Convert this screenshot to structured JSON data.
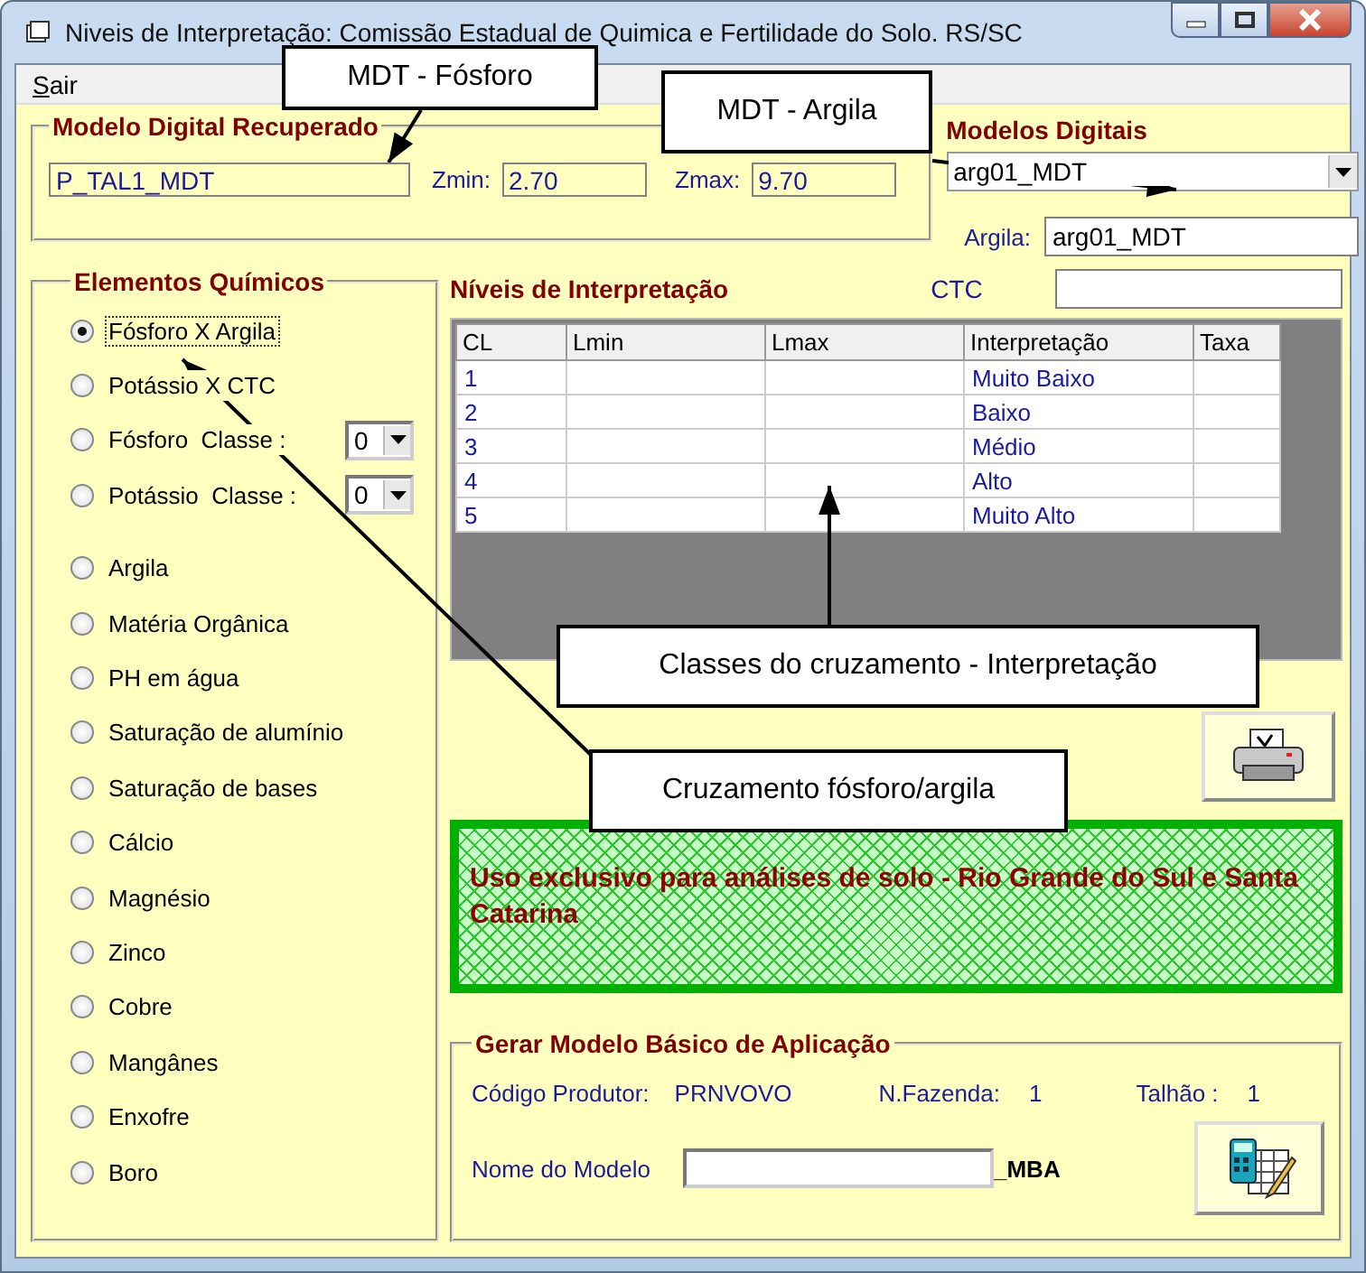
{
  "window": {
    "title": "Niveis de Interpretação: Comissão Estadual de Quimica e Fertilidade do Solo.  RS/SC"
  },
  "menu": [
    {
      "label": "Sair"
    }
  ],
  "modelo_digital_recuperado": {
    "title": "Modelo Digital Recuperado",
    "model": "P_TAL1_MDT",
    "zmin_label": "Zmin:",
    "zmin": "2.70",
    "zmax_label": "Zmax:",
    "zmax": "9.70"
  },
  "modelos_digitais": {
    "title": "Modelos Digitais",
    "combo_value": "arg01_MDT",
    "argila_label": "Argila:",
    "argila_value": "arg01_MDT",
    "ctc_label": "CTC"
  },
  "elementos": {
    "title": "Elementos Químicos",
    "items": [
      {
        "kind": "radio",
        "label": "Fósforo X Argila",
        "selected": true,
        "focused": true
      },
      {
        "kind": "radio",
        "label": "Potássio X CTC",
        "selected": false,
        "focused": false
      },
      {
        "kind": "combo",
        "label": "Fósforo  Classe :",
        "selected": false,
        "focused": false,
        "class_value": "0"
      },
      {
        "kind": "combo",
        "label": "Potássio  Classe :",
        "selected": false,
        "focused": false,
        "class_value": "0"
      },
      {
        "kind": "radio",
        "label": "Argila",
        "selected": false,
        "focused": false
      },
      {
        "kind": "radio",
        "label": "Matéria Orgânica",
        "selected": false,
        "focused": false
      },
      {
        "kind": "radio",
        "label": "PH em água",
        "selected": false,
        "focused": false
      },
      {
        "kind": "radio",
        "label": "Saturação de alumínio",
        "selected": false,
        "focused": false
      },
      {
        "kind": "radio",
        "label": "Saturação de bases",
        "selected": false,
        "focused": false
      },
      {
        "kind": "radio",
        "label": "Cálcio",
        "selected": false,
        "focused": false
      },
      {
        "kind": "radio",
        "label": "Magnésio",
        "selected": false,
        "focused": false
      },
      {
        "kind": "radio",
        "label": "Zinco",
        "selected": false,
        "focused": false
      },
      {
        "kind": "radio",
        "label": "Cobre",
        "selected": false,
        "focused": false
      },
      {
        "kind": "radio",
        "label": "Mangânes",
        "selected": false,
        "focused": false
      },
      {
        "kind": "radio",
        "label": "Enxofre",
        "selected": false,
        "focused": false
      },
      {
        "kind": "radio",
        "label": "Boro",
        "selected": false,
        "focused": false
      }
    ]
  },
  "niveis": {
    "title": "Níveis de Interpretação",
    "columns": [
      "CL",
      "Lmin",
      "Lmax",
      "Interpretação",
      "Taxa"
    ],
    "rows": [
      {
        "cl": "1",
        "interpretacao": "Muito Baixo"
      },
      {
        "cl": "2",
        "interpretacao": "Baixo"
      },
      {
        "cl": "3",
        "interpretacao": "Médio"
      },
      {
        "cl": "4",
        "interpretacao": "Alto"
      },
      {
        "cl": "5",
        "interpretacao": "Muito Alto"
      }
    ]
  },
  "notice": "Uso exclusivo para análises de solo - Rio Grande do Sul e Santa Catarina",
  "gerar": {
    "title": "Gerar Modelo Básico de Aplicação",
    "codigo_label": "Código Produtor:",
    "codigo": "PRNVOVO",
    "fazenda_label": "N.Fazenda:",
    "fazenda": "1",
    "talhao_label": "Talhão :",
    "talhao": "1",
    "nome_label": "Nome do Modelo",
    "suffix": "_MBA"
  },
  "callouts": [
    {
      "text": "MDT - Fósforo"
    },
    {
      "text": "MDT - Argila"
    },
    {
      "text": "Classes do cruzamento - Interpretação"
    },
    {
      "text": "Cruzamento fósforo/argila"
    }
  ]
}
